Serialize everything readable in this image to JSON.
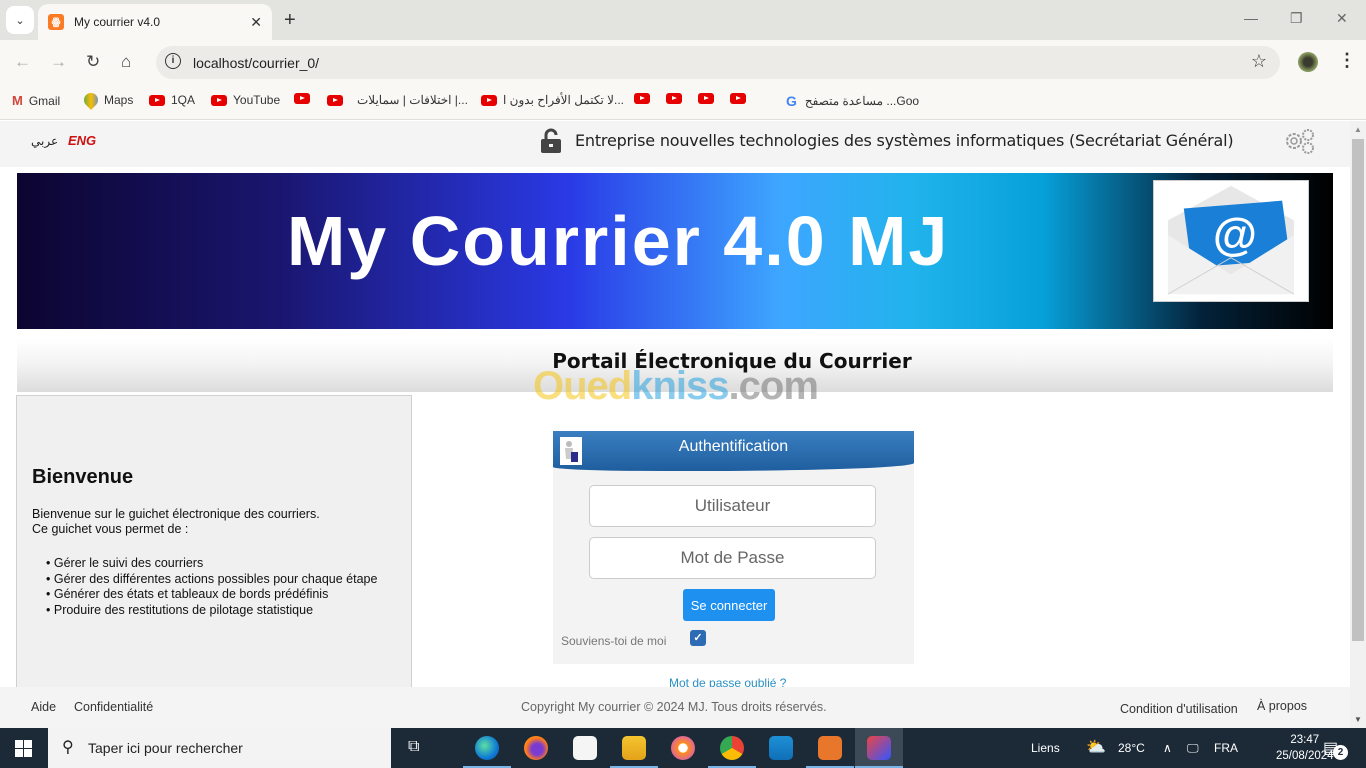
{
  "browser": {
    "tab_title": "My courrier v4.0",
    "tab_favicon": "xampp-icon",
    "url": "localhost/courrier_0/",
    "bookmarks": [
      {
        "label": "Gmail",
        "icon": "gmail-icon"
      },
      {
        "label": "Maps",
        "icon": "maps-icon"
      },
      {
        "label": "1QA",
        "icon": "youtube-icon"
      },
      {
        "label": "YouTube",
        "icon": "youtube-icon"
      },
      {
        "label": "",
        "icon": "youtube-icon"
      },
      {
        "label": "اختلافات | سمايلات |...",
        "icon": "youtube-icon"
      },
      {
        "label": "لا تكتمل الأفراح بدون ا...",
        "icon": "youtube-icon"
      },
      {
        "label": "",
        "icon": "youtube-icon"
      },
      {
        "label": "",
        "icon": "youtube-icon"
      },
      {
        "label": "",
        "icon": "youtube-icon"
      },
      {
        "label": "",
        "icon": "youtube-icon"
      },
      {
        "label": "مساعدة متصفح ...Goo",
        "icon": "google-icon"
      }
    ]
  },
  "header": {
    "lang_ar": "عربي",
    "lang_en": "ENG",
    "org_title": "Entreprise nouvelles technologies des systèmes informatiques (Secrétariat Général)"
  },
  "banner": {
    "title": "My Courrier 4.0 MJ"
  },
  "portal": {
    "title": "Portail Électronique du Courrier",
    "watermark": [
      "Oued",
      "kniss",
      ".com"
    ]
  },
  "welcome": {
    "heading": "Bienvenue",
    "intro_line1": "Bienvenue sur le guichet électronique des courriers.",
    "intro_line2": "Ce guichet vous permet de :",
    "items": [
      "Gérer le suivi des courriers",
      "Gérer des différentes actions possibles pour chaque étape",
      "Générer des états et tableaux de bords prédéfinis",
      "Produire des restitutions de pilotage statistique"
    ]
  },
  "auth": {
    "title": "Authentification",
    "username_placeholder": "Utilisateur",
    "username_value": "",
    "password_placeholder": "Mot de Passe",
    "password_value": "",
    "login_label": "Se connecter",
    "remember_label": "Souviens-toi de moi",
    "remember_checked": true,
    "forgot_label": "Mot de passe oublié ?"
  },
  "footer": {
    "help": "Aide",
    "privacy": "Confidentialité",
    "copyright": "Copyright My courrier © 2024 MJ. Tous droits réservés.",
    "terms": "Condition d'utilisation",
    "about": "À propos"
  },
  "taskbar": {
    "search_placeholder": "Taper ici pour rechercher",
    "links_label": "Liens",
    "temperature": "28°C",
    "language": "FRA",
    "time": "23:47",
    "date": "25/08/2024",
    "notifications": "2"
  },
  "colors": {
    "accent": "#1e90f0",
    "auth_header": "#2a6eb0",
    "lang_active": "#cc1111",
    "link": "#2a8fc2"
  }
}
